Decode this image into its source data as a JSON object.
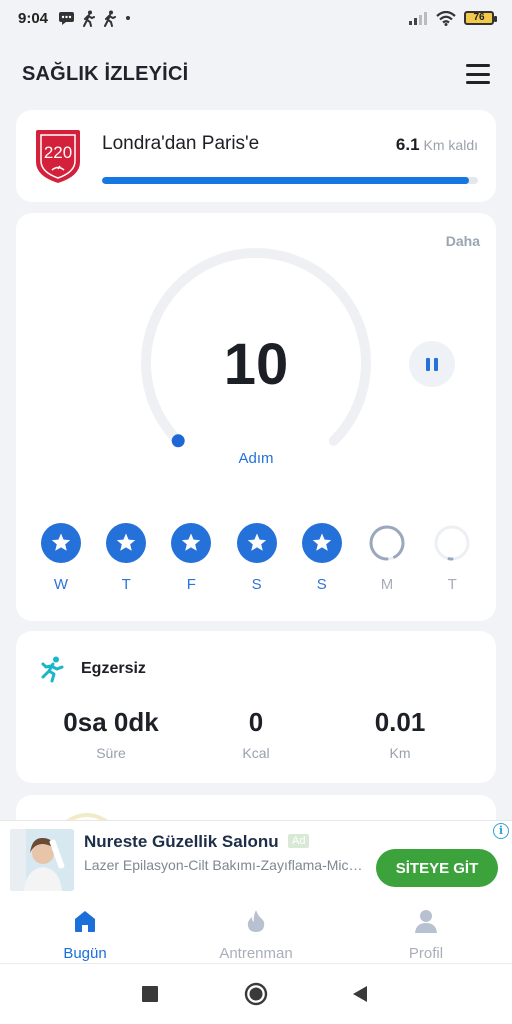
{
  "status_bar": {
    "time": "9:04",
    "battery": "76"
  },
  "header": {
    "title": "SAĞLIK İZLEYİCİ"
  },
  "route": {
    "badge": "220",
    "title": "Londra'dan Paris'e",
    "remaining_value": "6.1",
    "remaining_unit": "Km kaldı",
    "progress_fraction": 0.975
  },
  "steps": {
    "more_label": "Daha",
    "count": "10",
    "label": "Adım",
    "gauge_fraction": 0.0,
    "days": [
      {
        "label": "W",
        "done": true
      },
      {
        "label": "T",
        "done": true
      },
      {
        "label": "F",
        "done": true
      },
      {
        "label": "S",
        "done": true
      },
      {
        "label": "S",
        "done": true
      },
      {
        "label": "M",
        "done": false,
        "progress": 0.92
      },
      {
        "label": "T",
        "done": false,
        "progress": 0.03
      }
    ]
  },
  "exercise": {
    "title": "Egzersiz",
    "stats": [
      {
        "value": "0sa 0dk",
        "label": "Süre"
      },
      {
        "value": "0",
        "label": "Kcal"
      },
      {
        "value": "0.01",
        "label": "Km"
      }
    ]
  },
  "ad": {
    "title": "Nureste Güzellik Salonu",
    "tag": "Ad",
    "description": "Lazer Epilasyon-Cilt Bakımı-Zayıflama-Microblading-Kalıcı Makyaj",
    "cta": "SİTEYE GİT",
    "info": "i"
  },
  "bottom_nav": [
    {
      "label": "Bugün",
      "icon": "home-icon",
      "active": true
    },
    {
      "label": "Antrenman",
      "icon": "flame-icon",
      "active": false
    },
    {
      "label": "Profil",
      "icon": "person-icon",
      "active": false
    }
  ],
  "colors": {
    "accent": "#2471d9",
    "progress": "#1677e3",
    "badge": "#d4213b",
    "cta": "#3ca33c"
  }
}
